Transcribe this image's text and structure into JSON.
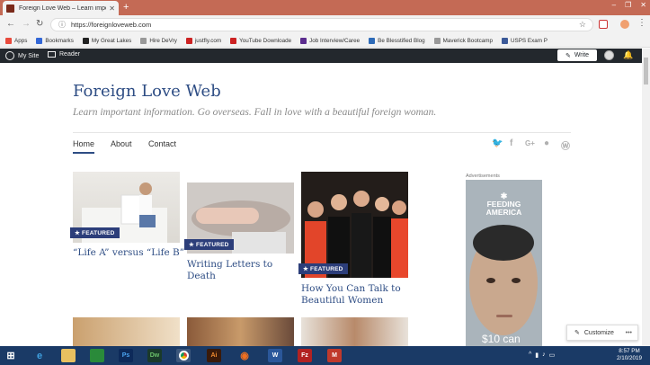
{
  "browser": {
    "tab_title": "Foreign Love Web – Learn impo",
    "new_tab": "+",
    "url": "https://foreignloveweb.com",
    "window_min": "–",
    "window_max": "❐",
    "window_close": "✕"
  },
  "bookmarks": [
    {
      "label": "Apps",
      "color": "#e84a3c"
    },
    {
      "label": "Bookmarks",
      "color": "#3367d6"
    },
    {
      "label": "My Great Lakes",
      "color": "#222222"
    },
    {
      "label": "Hire DeVry",
      "color": "#999999"
    },
    {
      "label": "justfly.com",
      "color": "#cc2222"
    },
    {
      "label": "YouTube Downloade",
      "color": "#cc2222"
    },
    {
      "label": "Job Interview/Caree",
      "color": "#5b2d8e"
    },
    {
      "label": "Be Blesstified Blog",
      "color": "#2e6bb8"
    },
    {
      "label": "Maverick Bootcamp",
      "color": "#999999"
    },
    {
      "label": "USPS Exam P",
      "color": "#3b5998"
    }
  ],
  "adminbar": {
    "my_site": "My Site",
    "reader": "Reader",
    "write": "Write"
  },
  "site": {
    "title": "Foreign Love Web",
    "tagline": "Learn important information. Go overseas. Fall in love with a beautiful foreign woman.",
    "menu": [
      "Home",
      "About",
      "Contact"
    ],
    "social_icons": [
      "twitter-icon",
      "facebook-icon",
      "google-plus-icon",
      "github-icon",
      "wordpress-icon"
    ]
  },
  "posts": [
    {
      "title": "“Life A” versus “Life B”",
      "badge": "★ FEATURED"
    },
    {
      "title": "Writing Letters to Death",
      "badge": "★ FEATURED"
    },
    {
      "title": "How You Can Talk to Beautiful Women",
      "badge": "★ FEATURED"
    }
  ],
  "ad": {
    "label": "Advertisements",
    "brand_line1": "FEEDING",
    "brand_line2": "AMERICA",
    "price": "$10 can"
  },
  "customize": {
    "label": "Customize",
    "more": "•••"
  },
  "taskbar": {
    "time": "8:57 PM",
    "date": "2/10/2019"
  }
}
